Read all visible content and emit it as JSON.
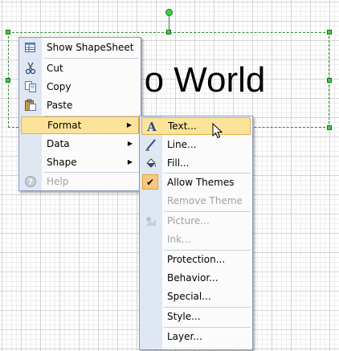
{
  "shape": {
    "text": "o World"
  },
  "context_menu": {
    "items": [
      {
        "label": "Show ShapeSheet",
        "icon": "shapesheet-icon"
      },
      {
        "label": "Cut",
        "icon": "scissors-icon"
      },
      {
        "label": "Copy",
        "icon": "copy-icon"
      },
      {
        "label": "Paste",
        "icon": "paste-icon"
      },
      {
        "label": "Format",
        "has_submenu": true,
        "active": true
      },
      {
        "label": "Data",
        "has_submenu": true
      },
      {
        "label": "Shape",
        "has_submenu": true
      },
      {
        "label": "Help",
        "icon": "help-icon",
        "disabled": true
      }
    ]
  },
  "format_submenu": {
    "items": [
      {
        "label": "Text...",
        "icon": "text-a-icon",
        "highlighted": true
      },
      {
        "label": "Line...",
        "icon": "line-pen-icon"
      },
      {
        "label": "Fill...",
        "icon": "fill-bucket-icon"
      },
      {
        "label": "Allow Themes",
        "icon": "check-icon",
        "checked": true
      },
      {
        "label": "Remove Theme",
        "disabled": true
      },
      {
        "label": "Picture...",
        "icon": "picture-icon",
        "disabled": true
      },
      {
        "label": "Ink...",
        "disabled": true
      },
      {
        "label": "Protection..."
      },
      {
        "label": "Behavior..."
      },
      {
        "label": "Special..."
      },
      {
        "label": "Style..."
      },
      {
        "label": "Layer..."
      }
    ]
  },
  "colors": {
    "highlight": "#fbe39a",
    "highlight_border": "#e1ae4c",
    "menu_gutter": "#dfe7f3",
    "selection": "#3ad13a"
  }
}
